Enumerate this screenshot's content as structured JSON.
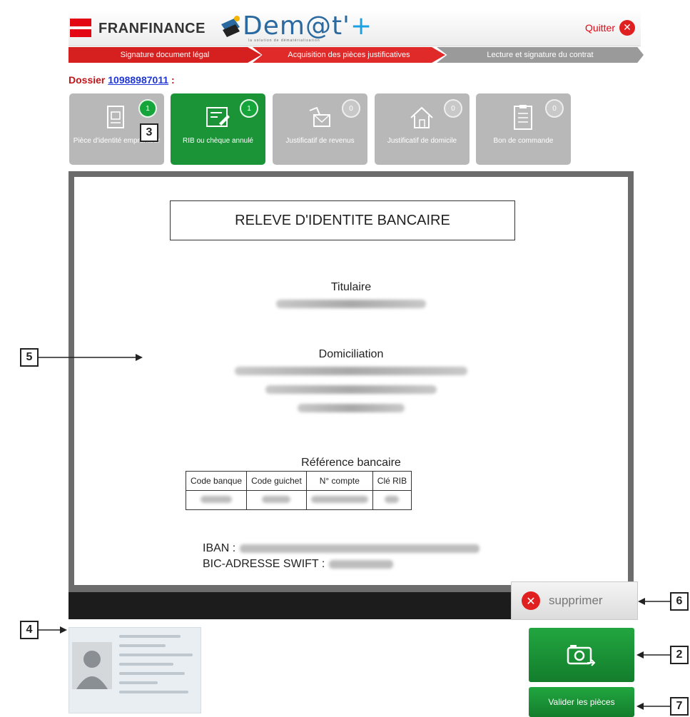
{
  "header": {
    "brand": "FRANFINANCE",
    "app_name": "Dem@t'",
    "app_plus": "+",
    "tagline": "la solution de dématérialisation",
    "quit_label": "Quitter"
  },
  "steps": [
    {
      "label": "Signature document légal",
      "state": "done"
    },
    {
      "label": "Acquisition des pièces justificatives",
      "state": "current"
    },
    {
      "label": "Lecture et signature du contrat",
      "state": "todo"
    }
  ],
  "dossier": {
    "prefix": "Dossier",
    "number": "10988987011",
    "suffix": ":"
  },
  "tiles": [
    {
      "label": "Pièce d'identité emprunteur",
      "count": "1",
      "active": false,
      "icon": "id-document-icon"
    },
    {
      "label": "RIB ou chèque annulé",
      "count": "1",
      "active": true,
      "icon": "cheque-icon"
    },
    {
      "label": "Justificatif de revenus",
      "count": "0",
      "active": false,
      "icon": "income-icon"
    },
    {
      "label": "Justificatif de domicile",
      "count": "0",
      "active": false,
      "icon": "house-icon"
    },
    {
      "label": "Bon de commande",
      "count": "0",
      "active": false,
      "icon": "order-form-icon"
    }
  ],
  "document": {
    "title": "RELEVE D'IDENTITE BANCAIRE",
    "holder_label": "Titulaire",
    "domiciliation_label": "Domiciliation",
    "reference_label": "Référence bancaire",
    "table_headers": [
      "Code banque",
      "Code guichet",
      "N° compte",
      "Clé RIB"
    ],
    "iban_label": "IBAN :",
    "bic_label": "BIC-ADRESSE SWIFT :"
  },
  "actions": {
    "delete_label": "supprimer",
    "validate_label": "Valider les pièces"
  },
  "callouts": {
    "c2": "2",
    "c3": "3",
    "c4": "4",
    "c5": "5",
    "c6": "6",
    "c7": "7"
  },
  "colors": {
    "brand_red": "#e30613",
    "active_green": "#1b9437",
    "link_blue": "#1f37d8"
  }
}
